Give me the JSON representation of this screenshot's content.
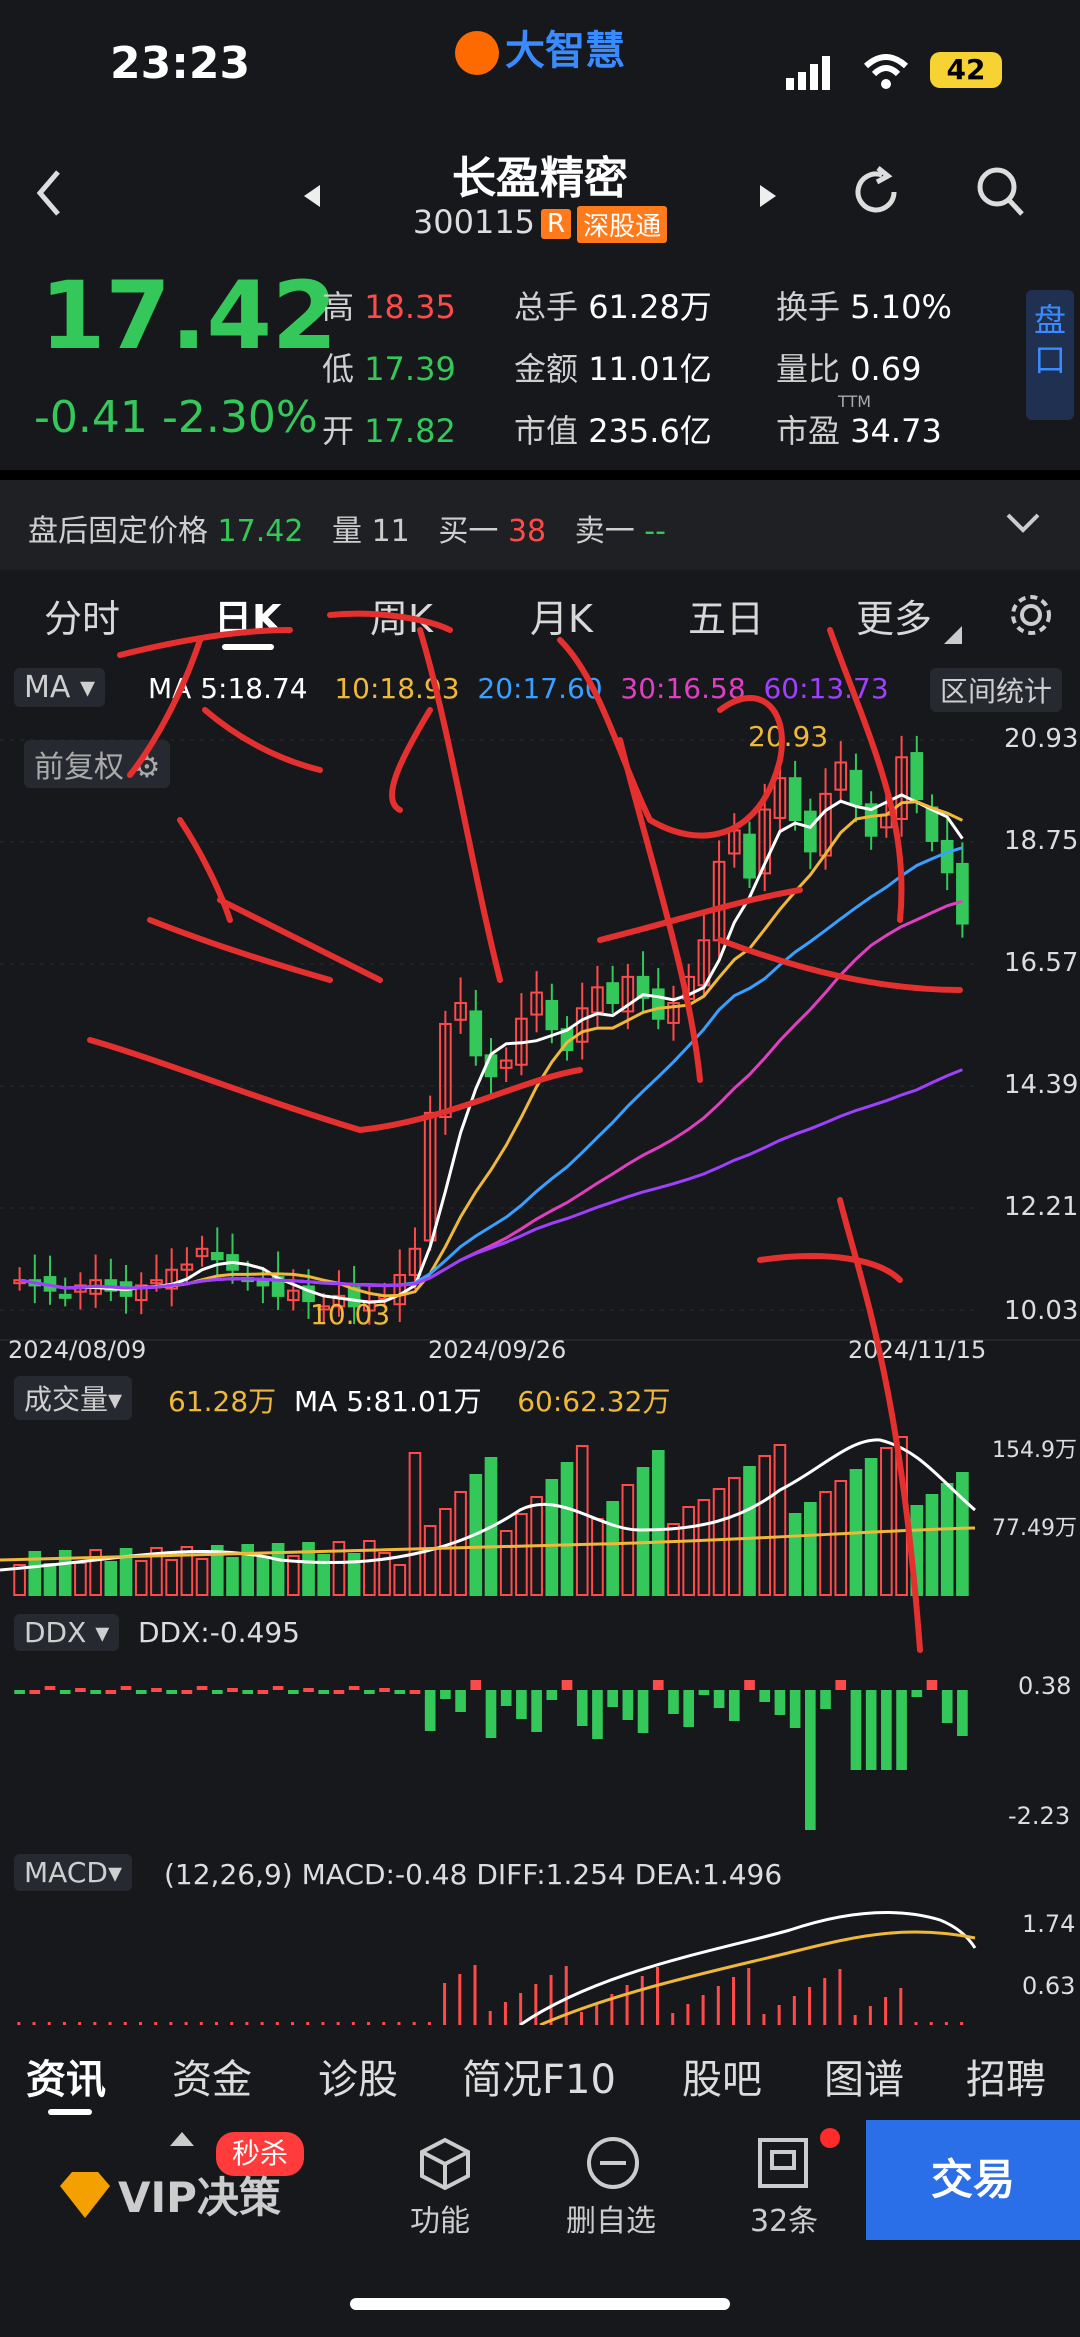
{
  "status_bar": {
    "time": "23:23",
    "brand": "大智慧",
    "battery": "42"
  },
  "header": {
    "stock_name": "长盈精密",
    "stock_code": "300115",
    "tag_r": "R",
    "tag_market": "深股通"
  },
  "quote": {
    "price": "17.42",
    "change": "-0.41",
    "change_pct": "-2.30%",
    "high_label": "高",
    "high": "18.35",
    "low_label": "低",
    "low": "17.39",
    "open_label": "开",
    "open": "17.82",
    "volume_label": "总手",
    "volume": "61.28万",
    "amount_label": "金额",
    "amount": "11.01亿",
    "mktcap_label": "市值",
    "mktcap": "235.6亿",
    "turnover_label": "换手",
    "turnover": "5.10%",
    "vol_ratio_label": "量比",
    "vol_ratio": "0.69",
    "pe_label": "市盈",
    "pe_sup": "TTM",
    "pe": "34.73",
    "side_button": "盘口"
  },
  "after_hours": {
    "label": "盘后固定价格",
    "price": "17.42",
    "qty_label": "量",
    "qty": "11",
    "buy_label": "买一",
    "buy": "38",
    "sell_label": "卖一",
    "sell": "--"
  },
  "period_tabs": [
    "分时",
    "日K",
    "周K",
    "月K",
    "五日",
    "更多"
  ],
  "active_tab": "日K",
  "ma_bar": {
    "selector": "MA",
    "ma5": "MA 5:18.74",
    "ma10": "10:18.93",
    "ma20": "20:17.60",
    "ma30": "30:16.58",
    "ma60": "60:13.73",
    "range_stat": "区间统计",
    "adjust": "前复权"
  },
  "colors": {
    "ma5": "#ffffff",
    "ma10": "#f0b83a",
    "ma20": "#3aa0ff",
    "ma30": "#e040c0",
    "ma60": "#a040ff",
    "up": "#ff4a4a",
    "down": "#34c759",
    "ink": "#e53030"
  },
  "chart_data": {
    "type": "candlestick",
    "price_axis": [
      "20.93",
      "18.75",
      "16.57",
      "14.39",
      "12.21",
      "10.03"
    ],
    "ylim": [
      10.03,
      20.93
    ],
    "dates": [
      "2024/08/09",
      "2024/09/26",
      "2024/11/15"
    ],
    "high_marker": "20.93",
    "low_marker": "10.03",
    "close": [
      10.6,
      10.5,
      10.4,
      10.3,
      10.5,
      10.6,
      10.4,
      10.3,
      10.5,
      10.6,
      10.8,
      10.9,
      11.2,
      11.0,
      10.8,
      10.6,
      10.5,
      10.3,
      10.4,
      10.2,
      10.1,
      10.3,
      10.1,
      10.2,
      10.3,
      10.7,
      11.2,
      13.8,
      15.5,
      15.9,
      14.9,
      14.5,
      14.8,
      15.6,
      16.1,
      15.4,
      15.0,
      15.8,
      16.2,
      15.9,
      16.4,
      16.0,
      15.6,
      15.9,
      16.4,
      17.1,
      18.6,
      19.2,
      18.3,
      19.6,
      20.2,
      19.4,
      18.8,
      19.9,
      20.5,
      19.7,
      19.1,
      19.5,
      20.6,
      19.8,
      19.0,
      18.4,
      17.42
    ],
    "volume": {
      "selector": "成交量",
      "current": "61.28万",
      "ma5": "MA 5:81.01万",
      "ma60": "60:62.32万",
      "axis": [
        "154.9万",
        "77.49万"
      ]
    },
    "ddx": {
      "selector": "DDX",
      "label": "DDX:-0.495",
      "axis": [
        "0.38",
        "-2.23"
      ]
    },
    "macd": {
      "selector": "MACD",
      "label": "(12,26,9) MACD:-0.48 DIFF:1.254 DEA:1.496",
      "axis": [
        "1.74",
        "0.63"
      ]
    }
  },
  "bottom_tabs": [
    "资讯",
    "资金",
    "诊股",
    "简况F10",
    "股吧",
    "图谱",
    "招聘"
  ],
  "action_bar": {
    "vip": "VIP决策",
    "vip_badge": "秒杀",
    "func": "功能",
    "remove_fav": "删自选",
    "msg": "32条",
    "trade": "交易"
  }
}
